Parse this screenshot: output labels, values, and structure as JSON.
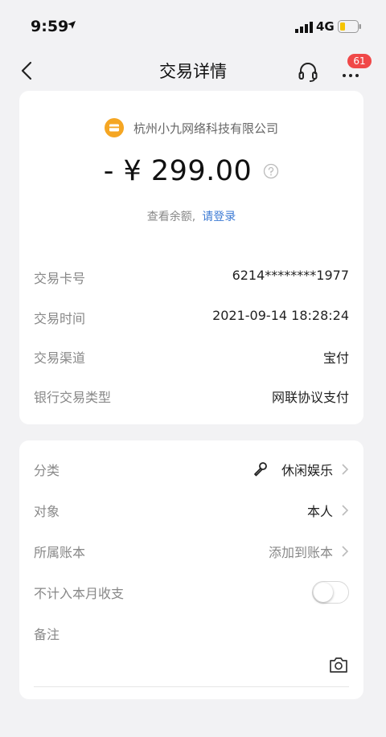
{
  "status": {
    "time": "9:59",
    "network": "4G"
  },
  "nav": {
    "title": "交易详情",
    "badge": "61"
  },
  "merchant": {
    "name": "杭州小九网络科技有限公司"
  },
  "amount": "- ¥ 299.00",
  "login": {
    "prefix": "查看余额,",
    "link": "请登录"
  },
  "details": [
    {
      "label": "交易卡号",
      "value": "6214********1977"
    },
    {
      "label": "交易时间",
      "value": "2021-09-14 18:28:24"
    },
    {
      "label": "交易渠道",
      "value": "宝付"
    },
    {
      "label": "银行交易类型",
      "value": "网联协议支付"
    }
  ],
  "options": {
    "category": {
      "label": "分类",
      "value": "休闲娱乐"
    },
    "target": {
      "label": "对象",
      "value": "本人"
    },
    "account": {
      "label": "所属账本",
      "value": "添加到账本"
    },
    "exclude": {
      "label": "不计入本月收支",
      "enabled": false
    },
    "note": {
      "label": "备注"
    }
  },
  "colors": {
    "accent": "#3d7bd4",
    "badge": "#f04848",
    "merchant_icon": "#f5a623"
  },
  "icons": [
    "back-arrow-icon",
    "headset-icon",
    "more-icon",
    "merchant-icon",
    "help-icon",
    "microphone-icon",
    "chevron-right-icon",
    "camera-icon"
  ]
}
